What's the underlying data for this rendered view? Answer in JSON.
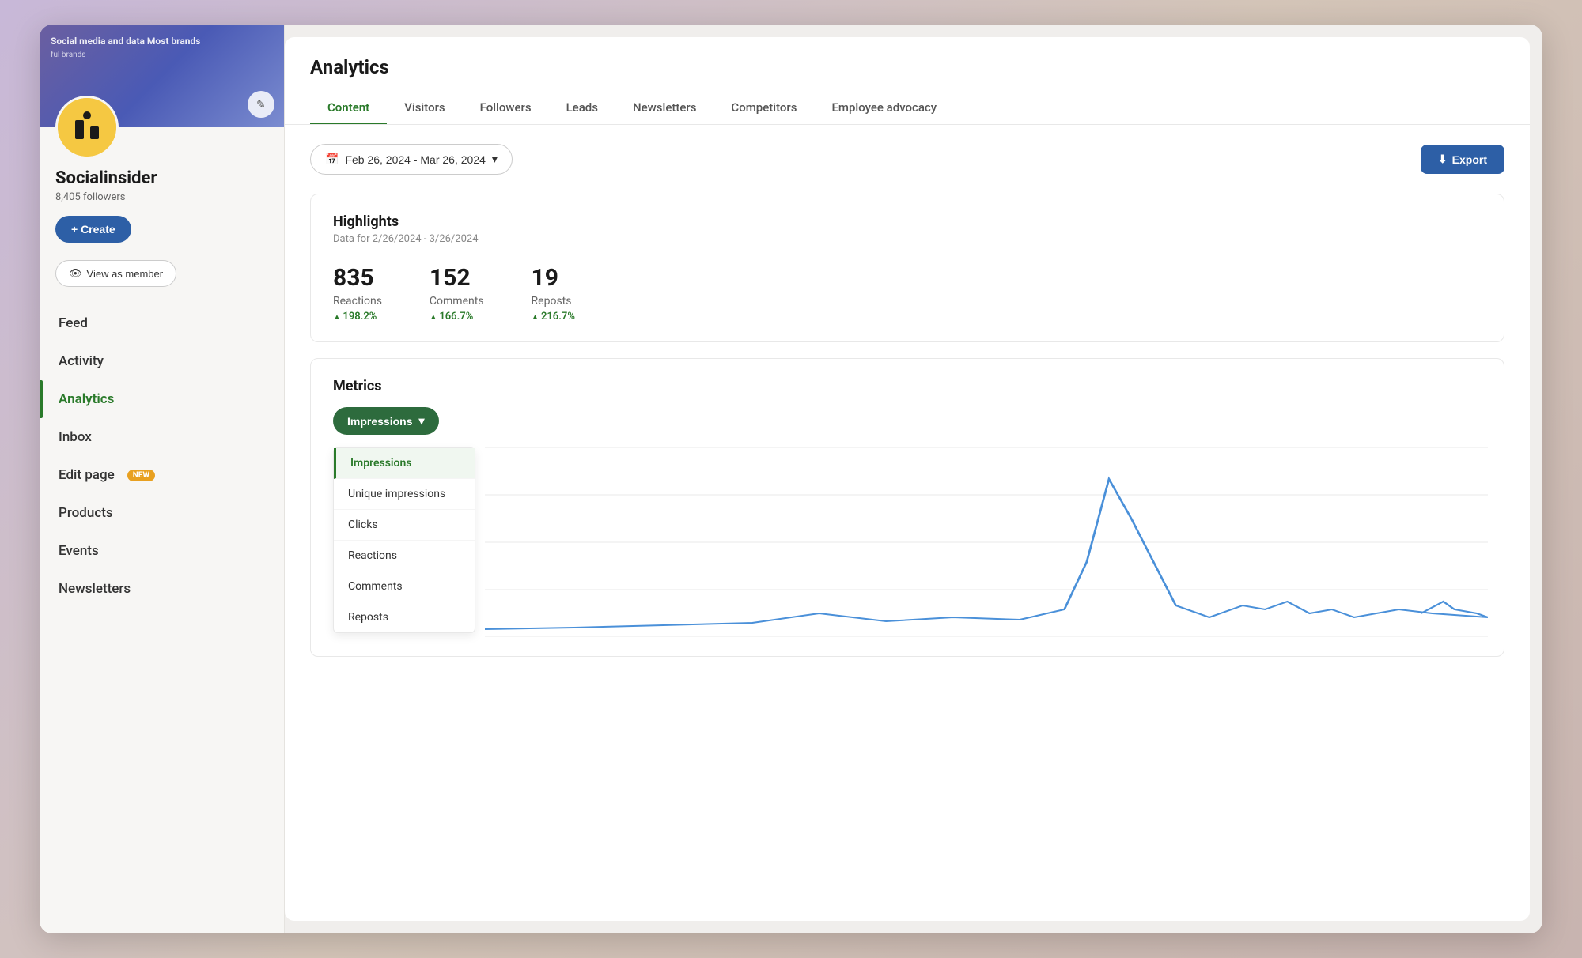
{
  "sidebar": {
    "profile": {
      "name": "Socialinsider",
      "followers_text": "8,405 followers"
    },
    "buttons": {
      "create": "+ Create",
      "view_as_member": "View as member"
    },
    "nav_items": [
      {
        "id": "feed",
        "label": "Feed",
        "active": false,
        "badge": null
      },
      {
        "id": "activity",
        "label": "Activity",
        "active": false,
        "badge": null
      },
      {
        "id": "analytics",
        "label": "Analytics",
        "active": true,
        "badge": null
      },
      {
        "id": "inbox",
        "label": "Inbox",
        "active": false,
        "badge": null
      },
      {
        "id": "edit-page",
        "label": "Edit page",
        "active": false,
        "badge": "NEW"
      },
      {
        "id": "products",
        "label": "Products",
        "active": false,
        "badge": null
      },
      {
        "id": "events",
        "label": "Events",
        "active": false,
        "badge": null
      },
      {
        "id": "newsletters",
        "label": "Newsletters",
        "active": false,
        "badge": null
      }
    ],
    "banner_text": "Social media and data Most brands"
  },
  "main": {
    "title": "Analytics",
    "tabs": [
      {
        "id": "content",
        "label": "Content",
        "active": true
      },
      {
        "id": "visitors",
        "label": "Visitors",
        "active": false
      },
      {
        "id": "followers",
        "label": "Followers",
        "active": false
      },
      {
        "id": "leads",
        "label": "Leads",
        "active": false
      },
      {
        "id": "newsletters",
        "label": "Newsletters",
        "active": false
      },
      {
        "id": "competitors",
        "label": "Competitors",
        "active": false
      },
      {
        "id": "employee-advocacy",
        "label": "Employee advocacy",
        "active": false
      }
    ],
    "date_range": {
      "label": "Feb 26, 2024 - Mar 26, 2024",
      "icon": "▾"
    },
    "export_button": "Export",
    "highlights": {
      "title": "Highlights",
      "subtitle": "Data for 2/26/2024 - 3/26/2024",
      "stats": [
        {
          "value": "835",
          "label": "Reactions",
          "change": "198.2%"
        },
        {
          "value": "152",
          "label": "Comments",
          "change": "166.7%"
        },
        {
          "value": "19",
          "label": "Reposts",
          "change": "216.7%"
        }
      ]
    },
    "metrics": {
      "title": "Metrics",
      "current_metric": "Impressions",
      "dropdown_items": [
        {
          "id": "impressions",
          "label": "Impressions",
          "selected": true
        },
        {
          "id": "unique-impressions",
          "label": "Unique impressions",
          "selected": false
        },
        {
          "id": "clicks",
          "label": "Clicks",
          "selected": false
        },
        {
          "id": "reactions",
          "label": "Reactions",
          "selected": false
        },
        {
          "id": "comments",
          "label": "Comments",
          "selected": false
        },
        {
          "id": "reposts",
          "label": "Reposts",
          "selected": false
        }
      ]
    }
  }
}
